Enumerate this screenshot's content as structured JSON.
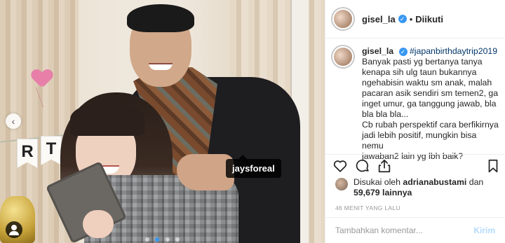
{
  "post": {
    "username": "gisel_la",
    "separator": "•",
    "follow_status": "Diikuti",
    "photo_tag": "jaysforeal",
    "banner_letters": [
      "R",
      "T"
    ],
    "caption": {
      "hashtag": "#japanbirthdaytrip2019",
      "lines": [
        "Banyak pasti yg bertanya tanya",
        "kenapa sih ulg taun bukannya",
        "ngehabisin waktu sm anak, malah",
        "pacaran asik sendiri sm temen2, ga",
        "inget umur, ga tanggung jawab, bla",
        "bla bla bla...",
        "Cb rubah perspektif cara berfikirnya",
        "jadi lebih positif, mungkin bisa nemu",
        "jawaban2 lain yg lbh baik?"
      ]
    },
    "likes": {
      "prefix": "Disukai oleh",
      "liker": "adrianabustami",
      "and": "dan",
      "count": "59,679 lainnya"
    },
    "timestamp": "46 MENIT YANG LALU",
    "comment": {
      "placeholder": "Tambahkan komentar...",
      "post_label": "Kirim"
    },
    "carousel": {
      "count": 4,
      "active": 1
    }
  },
  "icons": {
    "like": "heart-icon",
    "comment": "comment-icon",
    "share": "share-icon",
    "save": "bookmark-icon",
    "prev": "chevron-left-icon",
    "verified": "verified-badge-icon",
    "user_tags": "user-tag-icon"
  },
  "colors": {
    "verified": "#3897f0",
    "hashtag": "#003569",
    "post_button": "#b3dbff"
  }
}
